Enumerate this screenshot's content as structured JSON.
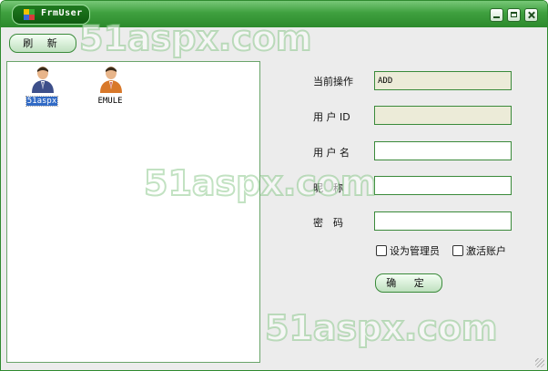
{
  "window": {
    "title": "FrmUser"
  },
  "toolbar": {
    "refresh_label": "刷 新"
  },
  "users": [
    {
      "name": "51aspx",
      "selected": true
    },
    {
      "name": "EMULE",
      "selected": false
    }
  ],
  "form": {
    "operation_label": "当前操作",
    "operation_value": "ADD",
    "userid_label": "用 户 ID",
    "userid_value": "",
    "username_label": "用 户 名",
    "username_value": "",
    "nickname_label": "昵　称",
    "nickname_value": "",
    "password_label": "密　码",
    "password_value": "",
    "set_admin_label": "设为管理员",
    "activate_label": "激活账户",
    "confirm_label": "确 定"
  },
  "watermarks": [
    "51aspx.com",
    "51aspx.com",
    "51aspx.com"
  ],
  "colors": {
    "title_green": "#2c8a2c",
    "border_green": "#3a8a3a",
    "selection_blue": "#316ac5"
  }
}
